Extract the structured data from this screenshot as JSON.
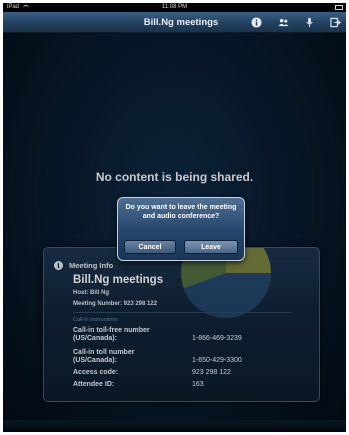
{
  "status_bar": {
    "carrier": "iPad",
    "time": "11:08 PM"
  },
  "toolbar": {
    "title": "Bill.Ng meetings",
    "icons": [
      "info-icon",
      "participants-icon",
      "microphone-icon",
      "leave-icon"
    ]
  },
  "main": {
    "no_content": "No content is being shared."
  },
  "meeting_info": {
    "header": "Meeting Info",
    "title": "Bill.Ng meetings",
    "host": "Host: Bill Ng",
    "meeting_number": "Meeting Number: 923 298 122",
    "call_in_header": "Call-in instructions",
    "rows": [
      {
        "label": "Call-in toll-free number",
        "label2": "(US/Canada):",
        "value": "1-866-469-3239"
      },
      {
        "label": "Call-in toll number",
        "label2": "(US/Canada):",
        "value": "1-650-429-3300"
      },
      {
        "label": "Access code:",
        "value": "923 298 122"
      },
      {
        "label": "Attendee ID:",
        "value": "163"
      }
    ]
  },
  "alert": {
    "message": "Do you want to leave the meeting and audio conference?",
    "cancel_label": "Cancel",
    "leave_label": "Leave"
  },
  "colors": {
    "background": "#081a2c",
    "toolbar": "#22415f",
    "panel": "#12263b",
    "alert": "#27486c"
  }
}
